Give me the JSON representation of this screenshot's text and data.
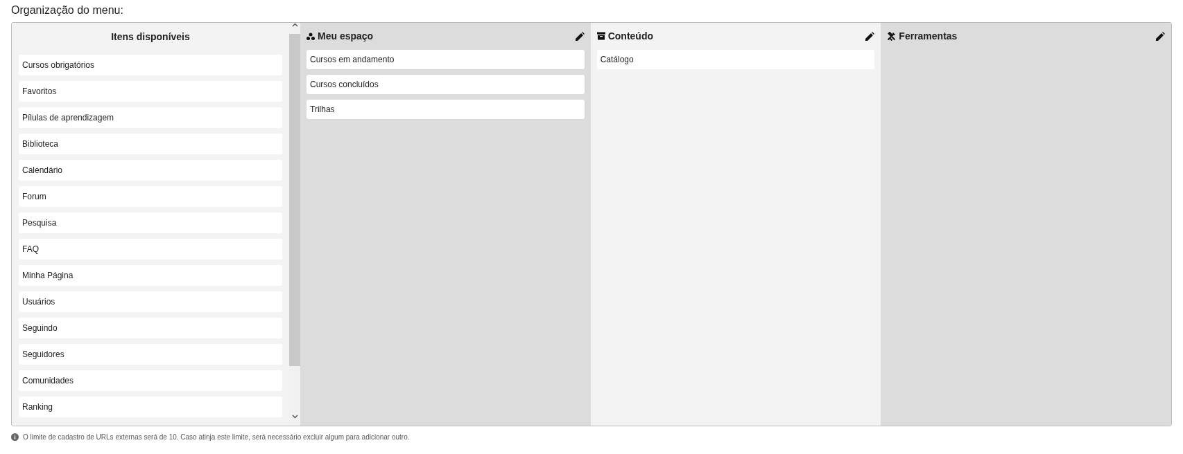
{
  "title": "Organização do menu:",
  "available": {
    "heading": "Itens disponíveis",
    "items": [
      "Cursos obrigatórios",
      "Favoritos",
      "Pílulas de aprendizagem",
      "Biblioteca",
      "Calendário",
      "Forum",
      "Pesquisa",
      "FAQ",
      "Minha Página",
      "Usuários",
      "Seguindo",
      "Seguidores",
      "Comunidades",
      "Ranking"
    ]
  },
  "groups": [
    {
      "kind": "people",
      "title": "Meu espaço",
      "items": [
        "Cursos em andamento",
        "Cursos concluídos",
        "Trilhas"
      ]
    },
    {
      "kind": "archive",
      "title": "Conteúdo",
      "items": [
        "Catálogo"
      ]
    },
    {
      "kind": "tools",
      "title": "Ferramentas"
    }
  ],
  "note": "O limite de cadastro de URLs externas será de 10. Caso atinja este limite, será necessário excluir algum para adicionar outro."
}
